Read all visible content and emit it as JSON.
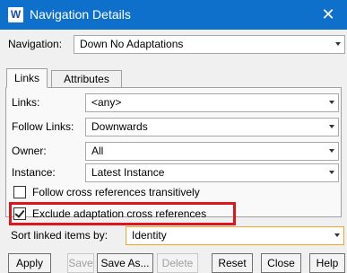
{
  "window": {
    "title": "Navigation Details",
    "app_icon": "W"
  },
  "navigation": {
    "label": "Navigation:",
    "value": "Down No Adaptations"
  },
  "tabs": [
    {
      "label": "Links"
    },
    {
      "label": "Attributes"
    }
  ],
  "fields": {
    "links": {
      "label": "Links:",
      "value": "<any>"
    },
    "follow_links": {
      "label": "Follow Links:",
      "value": "Downwards"
    },
    "owner": {
      "label": "Owner:",
      "value": "All"
    },
    "instance": {
      "label": "Instance:",
      "value": "Latest Instance"
    }
  },
  "checkboxes": {
    "follow_transitively": {
      "label": "Follow cross references transitively",
      "checked": false
    },
    "exclude_adaptation": {
      "label": "Exclude adaptation cross references",
      "checked": true
    }
  },
  "sort": {
    "label": "Sort linked items by:",
    "value": "Identity"
  },
  "buttons": {
    "apply": "Apply",
    "save": "Save",
    "save_as": "Save As...",
    "delete": "Delete",
    "reset": "Reset",
    "close": "Close",
    "help": "Help"
  },
  "colors": {
    "titlebar": "#0f70cc",
    "highlight": "#e0151b",
    "focus_border": "#f3a72a"
  }
}
